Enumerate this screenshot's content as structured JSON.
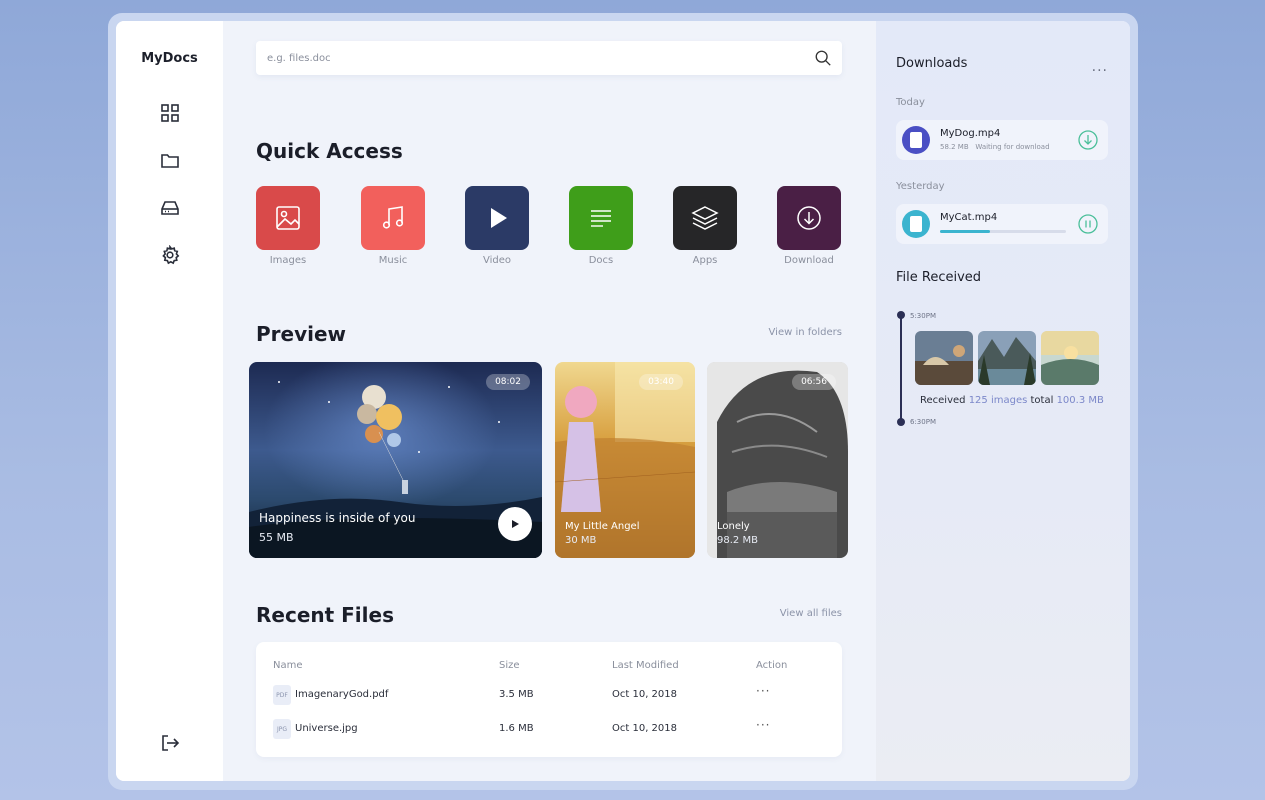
{
  "app": {
    "brand": "MyDocs"
  },
  "search": {
    "placeholder": "e.g. files.doc"
  },
  "quick_access": {
    "title": "Quick Access",
    "items": [
      {
        "label": "Images",
        "color": "#d94a4a"
      },
      {
        "label": "Music",
        "color": "#f2605c"
      },
      {
        "label": "Video",
        "color": "#2b3a66"
      },
      {
        "label": "Docs",
        "color": "#3f9e1a"
      },
      {
        "label": "Apps",
        "color": "#262628"
      },
      {
        "label": "Download",
        "color": "#4a1f45"
      }
    ]
  },
  "preview": {
    "title": "Preview",
    "link": "View in folders",
    "cards": [
      {
        "title": "Happiness is inside of you",
        "size": "55 MB",
        "duration": "08:02"
      },
      {
        "title": "My Little Angel",
        "size": "30 MB",
        "duration": "03:40"
      },
      {
        "title": "Lonely",
        "size": "98.2 MB",
        "duration": "06:56"
      }
    ]
  },
  "recent": {
    "title": "Recent Files",
    "link": "View all files",
    "columns": [
      "Name",
      "Size",
      "Last Modified",
      "Action"
    ],
    "rows": [
      {
        "type": "PDF",
        "name": "ImagenaryGod.pdf",
        "size": "3.5 MB",
        "modified": "Oct 10, 2018",
        "action": "···"
      },
      {
        "type": "JPG",
        "name": "Universe.jpg",
        "size": "1.6 MB",
        "modified": "Oct 10, 2018",
        "action": "···"
      }
    ]
  },
  "downloads": {
    "title": "Downloads",
    "more": "···",
    "groups": [
      {
        "label": "Today",
        "item": {
          "name": "MyDog.mp4",
          "size": "58.2 MB",
          "status": "Waiting for download",
          "color": "#4a4fc4"
        }
      },
      {
        "label": "Yesterday",
        "item": {
          "name": "MyCat.mp4",
          "progress": 0.4,
          "color": "#3bb4cf"
        }
      }
    ]
  },
  "received": {
    "title": "File Received",
    "start_time": "5:30PM",
    "end_time": "6:30PM",
    "prefix": "Received",
    "count": "125 images",
    "mid": "total",
    "total": "100.3 MB"
  }
}
